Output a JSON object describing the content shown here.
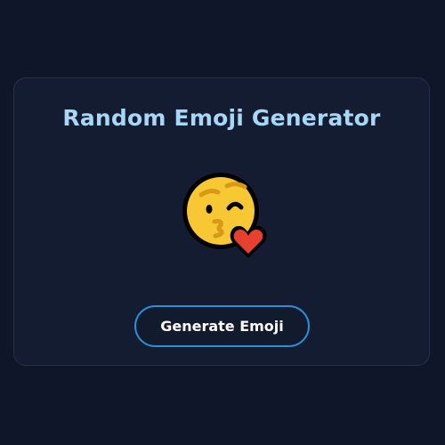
{
  "app": {
    "title": "Random Emoji Generator"
  },
  "emoji": {
    "icon_name": "face-blowing-a-kiss-icon",
    "glyph": "😘"
  },
  "actions": {
    "generate_label": "Generate Emoji"
  },
  "colors": {
    "page_background": "#0f1629",
    "card_background": "#131c31",
    "title": "#a9d6f5",
    "button_border": "#2b8fd6",
    "button_text": "#ffffff",
    "emoji_face": "#f7c734",
    "emoji_outline": "#000000",
    "emoji_heart": "#e8402f",
    "emoji_features": "#d69a16"
  }
}
